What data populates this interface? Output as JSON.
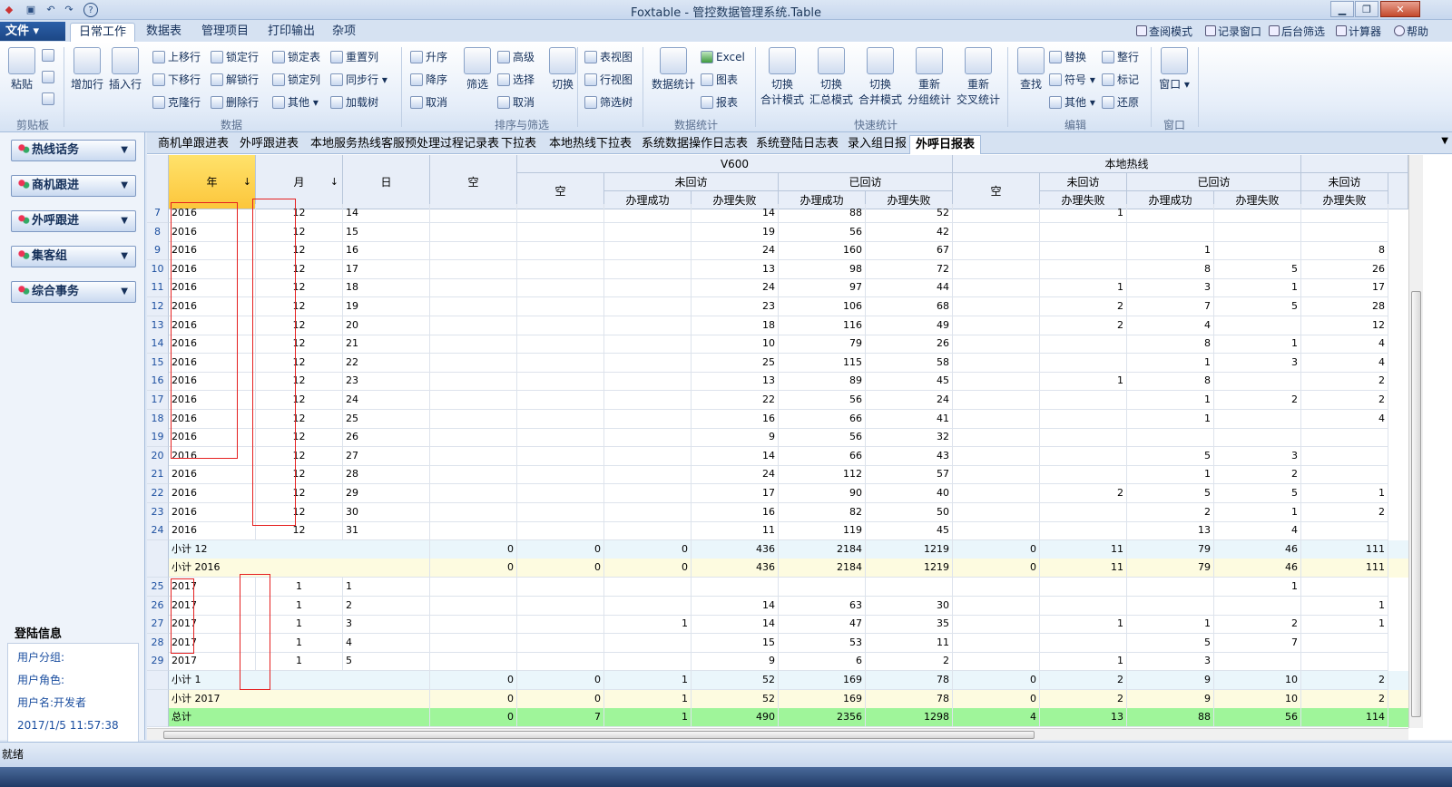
{
  "window": {
    "title": "Foxtable - 管控数据管理系统.Table"
  },
  "menu": {
    "file_label": "文件",
    "tabs": [
      "日常工作",
      "数据表",
      "管理项目",
      "打印输出",
      "杂项"
    ],
    "right_items": [
      "查阅模式",
      "记录窗口",
      "后台筛选",
      "计算器",
      "帮助"
    ]
  },
  "ribbon": {
    "clipboard": {
      "paste": "粘贴",
      "group": "剪贴板"
    },
    "data": {
      "add_row": "增加行",
      "insert_row": "插入行",
      "move_up": "上移行",
      "move_down": "下移行",
      "clone_row": "克隆行",
      "lock_row": "锁定行",
      "unlock_row": "解锁行",
      "delete_row": "删除行",
      "lock_table": "锁定表",
      "lock_col": "锁定列",
      "other": "其他",
      "reset_col": "重置列",
      "sync_row": "同步行",
      "load_tree": "加载树",
      "group": "数据"
    },
    "sort": {
      "asc": "升序",
      "desc": "降序",
      "cancel": "取消",
      "filter": "筛选",
      "advanced": "高级",
      "select": "选择",
      "cancel2": "取消",
      "switch": "切换",
      "group": "排序与筛选"
    },
    "view": {
      "table_view": "表视图",
      "row_view": "行视图",
      "filter_tree": "筛选树"
    },
    "stats": {
      "data_stats": "数据统计",
      "excel": "Excel",
      "chart": "图表",
      "report": "报表",
      "group": "数据统计"
    },
    "quick": {
      "sum_mode": [
        "切换",
        "合计模式"
      ],
      "summary_mode": [
        "切换",
        "汇总模式"
      ],
      "merge_mode": [
        "切换",
        "合并模式"
      ],
      "regroup": [
        "重新",
        "分组统计"
      ],
      "crosstab": [
        "重新",
        "交叉统计"
      ],
      "group": "快速统计"
    },
    "edit": {
      "find": "查找",
      "replace": "替换",
      "symbol": "符号",
      "other": "其他",
      "tidy_row": "整行",
      "mark": "标记",
      "restore": "还原",
      "group": "编辑"
    },
    "window": {
      "window": "窗口",
      "group": "窗口"
    }
  },
  "sidebar": {
    "items": [
      "热线话务",
      "商机跟进",
      "外呼跟进",
      "集客组",
      "综合事务"
    ],
    "login_title": "登陆信息",
    "login_lines": [
      "用户分组:",
      "用户角色:",
      "用户名:开发者",
      "2017/1/5 11:57:38"
    ]
  },
  "sheet_tabs": [
    "商机单跟进表",
    "外呼跟进表",
    "本地服务热线客服预处理过程记录表",
    "下拉表",
    "本地热线下拉表",
    "系统数据操作日志表",
    "系统登陆日志表",
    "录入组日报",
    "外呼日报表"
  ],
  "active_sheet": "外呼日报表",
  "grid": {
    "headers": {
      "year": "年",
      "month": "月",
      "day": "日",
      "empty": "空",
      "v600": "V600",
      "local": "本地热线",
      "not_visited": "未回访",
      "visited": "已回访",
      "success": "办理成功",
      "fail": "办理失败"
    },
    "rows": [
      {
        "n": "7",
        "year": "2016",
        "month": "12",
        "day": "14",
        "e": "",
        "v0": "",
        "v1": "",
        "v2": "14",
        "v3": "88",
        "v4": "52",
        "l0": "",
        "l1": "1",
        "l2": "",
        "l3": "",
        "l4": ""
      },
      {
        "n": "8",
        "year": "2016",
        "month": "12",
        "day": "15",
        "e": "",
        "v0": "",
        "v1": "",
        "v2": "19",
        "v3": "56",
        "v4": "42",
        "l0": "",
        "l1": "",
        "l2": "",
        "l3": "",
        "l4": ""
      },
      {
        "n": "9",
        "year": "2016",
        "month": "12",
        "day": "16",
        "e": "",
        "v0": "",
        "v1": "",
        "v2": "24",
        "v3": "160",
        "v4": "67",
        "l0": "",
        "l1": "",
        "l2": "1",
        "l3": "",
        "l4": "8"
      },
      {
        "n": "10",
        "year": "2016",
        "month": "12",
        "day": "17",
        "e": "",
        "v0": "",
        "v1": "",
        "v2": "13",
        "v3": "98",
        "v4": "72",
        "l0": "",
        "l1": "",
        "l2": "8",
        "l3": "5",
        "l4": "26"
      },
      {
        "n": "11",
        "year": "2016",
        "month": "12",
        "day": "18",
        "e": "",
        "v0": "",
        "v1": "",
        "v2": "24",
        "v3": "97",
        "v4": "44",
        "l0": "",
        "l1": "1",
        "l2": "3",
        "l3": "1",
        "l4": "17"
      },
      {
        "n": "12",
        "year": "2016",
        "month": "12",
        "day": "19",
        "e": "",
        "v0": "",
        "v1": "",
        "v2": "23",
        "v3": "106",
        "v4": "68",
        "l0": "",
        "l1": "2",
        "l2": "7",
        "l3": "5",
        "l4": "28"
      },
      {
        "n": "13",
        "year": "2016",
        "month": "12",
        "day": "20",
        "e": "",
        "v0": "",
        "v1": "",
        "v2": "18",
        "v3": "116",
        "v4": "49",
        "l0": "",
        "l1": "2",
        "l2": "4",
        "l3": "",
        "l4": "12"
      },
      {
        "n": "14",
        "year": "2016",
        "month": "12",
        "day": "21",
        "e": "",
        "v0": "",
        "v1": "",
        "v2": "10",
        "v3": "79",
        "v4": "26",
        "l0": "",
        "l1": "",
        "l2": "8",
        "l3": "1",
        "l4": "4"
      },
      {
        "n": "15",
        "year": "2016",
        "month": "12",
        "day": "22",
        "e": "",
        "v0": "",
        "v1": "",
        "v2": "25",
        "v3": "115",
        "v4": "58",
        "l0": "",
        "l1": "",
        "l2": "1",
        "l3": "3",
        "l4": "4"
      },
      {
        "n": "16",
        "year": "2016",
        "month": "12",
        "day": "23",
        "e": "",
        "v0": "",
        "v1": "",
        "v2": "13",
        "v3": "89",
        "v4": "45",
        "l0": "",
        "l1": "1",
        "l2": "8",
        "l3": "",
        "l4": "2"
      },
      {
        "n": "17",
        "year": "2016",
        "month": "12",
        "day": "24",
        "e": "",
        "v0": "",
        "v1": "",
        "v2": "22",
        "v3": "56",
        "v4": "24",
        "l0": "",
        "l1": "",
        "l2": "1",
        "l3": "2",
        "l4": "2"
      },
      {
        "n": "18",
        "year": "2016",
        "month": "12",
        "day": "25",
        "e": "",
        "v0": "",
        "v1": "",
        "v2": "16",
        "v3": "66",
        "v4": "41",
        "l0": "",
        "l1": "",
        "l2": "1",
        "l3": "",
        "l4": "4"
      },
      {
        "n": "19",
        "year": "2016",
        "month": "12",
        "day": "26",
        "e": "",
        "v0": "",
        "v1": "",
        "v2": "9",
        "v3": "56",
        "v4": "32",
        "l0": "",
        "l1": "",
        "l2": "",
        "l3": "",
        "l4": ""
      },
      {
        "n": "20",
        "year": "2016",
        "month": "12",
        "day": "27",
        "e": "",
        "v0": "",
        "v1": "",
        "v2": "14",
        "v3": "66",
        "v4": "43",
        "l0": "",
        "l1": "",
        "l2": "5",
        "l3": "3",
        "l4": ""
      },
      {
        "n": "21",
        "year": "2016",
        "month": "12",
        "day": "28",
        "e": "",
        "v0": "",
        "v1": "",
        "v2": "24",
        "v3": "112",
        "v4": "57",
        "l0": "",
        "l1": "",
        "l2": "1",
        "l3": "2",
        "l4": ""
      },
      {
        "n": "22",
        "year": "2016",
        "month": "12",
        "day": "29",
        "e": "",
        "v0": "",
        "v1": "",
        "v2": "17",
        "v3": "90",
        "v4": "40",
        "l0": "",
        "l1": "2",
        "l2": "5",
        "l3": "5",
        "l4": "1"
      },
      {
        "n": "23",
        "year": "2016",
        "month": "12",
        "day": "30",
        "e": "",
        "v0": "",
        "v1": "",
        "v2": "16",
        "v3": "82",
        "v4": "50",
        "l0": "",
        "l1": "",
        "l2": "2",
        "l3": "1",
        "l4": "2"
      },
      {
        "n": "24",
        "year": "2016",
        "month": "12",
        "day": "31",
        "e": "",
        "v0": "",
        "v1": "",
        "v2": "11",
        "v3": "119",
        "v4": "45",
        "l0": "",
        "l1": "",
        "l2": "13",
        "l3": "4",
        "l4": ""
      },
      {
        "n": "",
        "label": "小计  12",
        "kind": "sub1",
        "e": "0",
        "v0": "0",
        "v1": "0",
        "v2": "436",
        "v3": "2184",
        "v4": "1219",
        "l0": "0",
        "l1": "11",
        "l2": "79",
        "l3": "46",
        "l4": "111"
      },
      {
        "n": "",
        "label": "小计  2016",
        "kind": "sub2",
        "e": "0",
        "v0": "0",
        "v1": "0",
        "v2": "436",
        "v3": "2184",
        "v4": "1219",
        "l0": "0",
        "l1": "11",
        "l2": "79",
        "l3": "46",
        "l4": "111"
      },
      {
        "n": "25",
        "year": "2017",
        "month": "1",
        "day": "1",
        "e": "",
        "v0": "",
        "v1": "",
        "v2": "",
        "v3": "",
        "v4": "",
        "l0": "",
        "l1": "",
        "l2": "",
        "l3": "1",
        "l4": ""
      },
      {
        "n": "26",
        "year": "2017",
        "month": "1",
        "day": "2",
        "e": "",
        "v0": "",
        "v1": "",
        "v2": "14",
        "v3": "63",
        "v4": "30",
        "l0": "",
        "l1": "",
        "l2": "",
        "l3": "",
        "l4": "1"
      },
      {
        "n": "27",
        "year": "2017",
        "month": "1",
        "day": "3",
        "e": "",
        "v0": "",
        "v1": "1",
        "v2": "14",
        "v3": "47",
        "v4": "35",
        "l0": "",
        "l1": "1",
        "l2": "1",
        "l3": "2",
        "l4": "1"
      },
      {
        "n": "28",
        "year": "2017",
        "month": "1",
        "day": "4",
        "e": "",
        "v0": "",
        "v1": "",
        "v2": "15",
        "v3": "53",
        "v4": "11",
        "l0": "",
        "l1": "",
        "l2": "5",
        "l3": "7",
        "l4": ""
      },
      {
        "n": "29",
        "year": "2017",
        "month": "1",
        "day": "5",
        "e": "",
        "v0": "",
        "v1": "",
        "v2": "9",
        "v3": "6",
        "v4": "2",
        "l0": "",
        "l1": "1",
        "l2": "3",
        "l3": "",
        "l4": ""
      },
      {
        "n": "",
        "label": "小计  1",
        "kind": "sub1",
        "e": "0",
        "v0": "0",
        "v1": "1",
        "v2": "52",
        "v3": "169",
        "v4": "78",
        "l0": "0",
        "l1": "2",
        "l2": "9",
        "l3": "10",
        "l4": "2"
      },
      {
        "n": "",
        "label": "小计  2017",
        "kind": "sub2",
        "e": "0",
        "v0": "0",
        "v1": "1",
        "v2": "52",
        "v3": "169",
        "v4": "78",
        "l0": "0",
        "l1": "2",
        "l2": "9",
        "l3": "10",
        "l4": "2"
      },
      {
        "n": "",
        "label": "总计",
        "kind": "total",
        "e": "0",
        "v0": "7",
        "v1": "1",
        "v2": "490",
        "v3": "2356",
        "v4": "1298",
        "l0": "4",
        "l1": "13",
        "l2": "88",
        "l3": "56",
        "l4": "114"
      }
    ]
  },
  "statusbar": {
    "text": "就绪"
  },
  "colors": {
    "sub1": "#eaf6fb",
    "sub2": "#fdfbe0",
    "total": "#9ff59a",
    "year_header": "#fcd65a",
    "annotation": "#e52020"
  }
}
